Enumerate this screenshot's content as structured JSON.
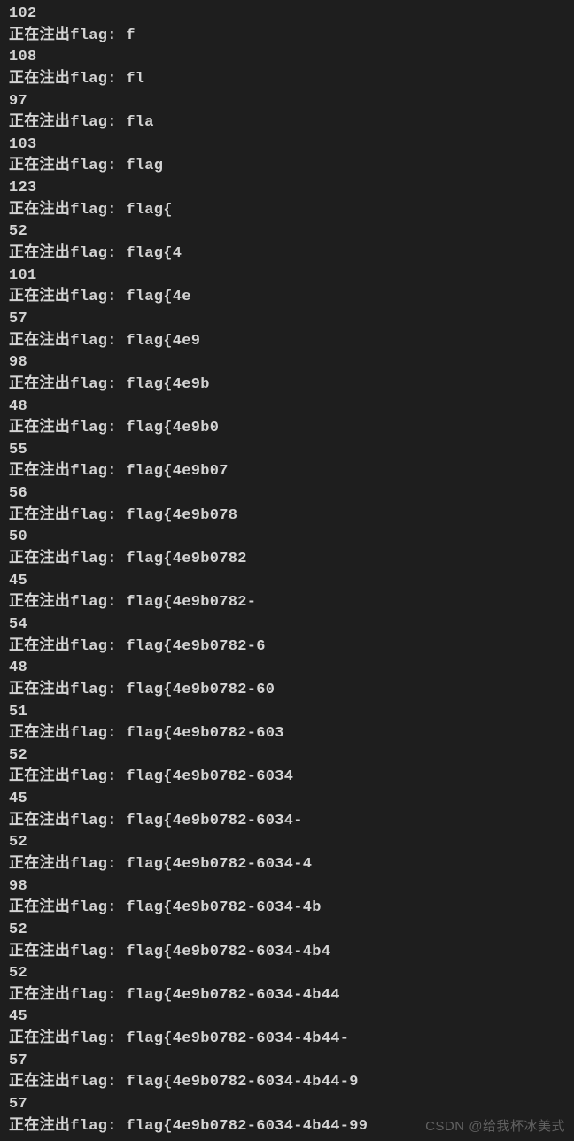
{
  "label_prefix": "正在注出flag: ",
  "entries": [
    {
      "code": "102",
      "flag": "f"
    },
    {
      "code": "108",
      "flag": "fl"
    },
    {
      "code": "97",
      "flag": "fla"
    },
    {
      "code": "103",
      "flag": "flag"
    },
    {
      "code": "123",
      "flag": "flag{"
    },
    {
      "code": "52",
      "flag": "flag{4"
    },
    {
      "code": "101",
      "flag": "flag{4e"
    },
    {
      "code": "57",
      "flag": "flag{4e9"
    },
    {
      "code": "98",
      "flag": "flag{4e9b"
    },
    {
      "code": "48",
      "flag": "flag{4e9b0"
    },
    {
      "code": "55",
      "flag": "flag{4e9b07"
    },
    {
      "code": "56",
      "flag": "flag{4e9b078"
    },
    {
      "code": "50",
      "flag": "flag{4e9b0782"
    },
    {
      "code": "45",
      "flag": "flag{4e9b0782-"
    },
    {
      "code": "54",
      "flag": "flag{4e9b0782-6"
    },
    {
      "code": "48",
      "flag": "flag{4e9b0782-60"
    },
    {
      "code": "51",
      "flag": "flag{4e9b0782-603"
    },
    {
      "code": "52",
      "flag": "flag{4e9b0782-6034"
    },
    {
      "code": "45",
      "flag": "flag{4e9b0782-6034-"
    },
    {
      "code": "52",
      "flag": "flag{4e9b0782-6034-4"
    },
    {
      "code": "98",
      "flag": "flag{4e9b0782-6034-4b"
    },
    {
      "code": "52",
      "flag": "flag{4e9b0782-6034-4b4"
    },
    {
      "code": "52",
      "flag": "flag{4e9b0782-6034-4b44"
    },
    {
      "code": "45",
      "flag": "flag{4e9b0782-6034-4b44-"
    },
    {
      "code": "57",
      "flag": "flag{4e9b0782-6034-4b44-9"
    },
    {
      "code": "57",
      "flag": "flag{4e9b0782-6034-4b44-99"
    }
  ],
  "watermark": "CSDN @给我杯冰美式"
}
